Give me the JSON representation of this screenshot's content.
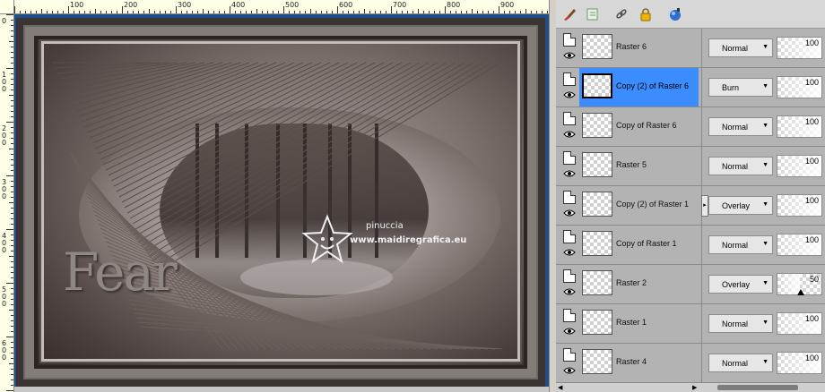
{
  "ruler": {
    "top_labels": [
      "100",
      "200",
      "300",
      "400",
      "500",
      "600",
      "700",
      "800",
      "900"
    ],
    "left_labels": [
      "0",
      "100",
      "200",
      "300",
      "400",
      "500",
      "600"
    ]
  },
  "artwork": {
    "logo_text": "Fear",
    "watermark_name": "pinuccia",
    "watermark_url": "www.maidiregrafica.eu"
  },
  "toolbar": {
    "icons": [
      "brush-icon",
      "layer-properties-icon",
      "link-icon",
      "lock-icon",
      "mask-icon"
    ]
  },
  "layers": [
    {
      "name": "Raster 6",
      "blend": "Normal",
      "opacity": "100",
      "selected": false
    },
    {
      "name": "Copy (2) of Raster 6",
      "blend": "Burn",
      "opacity": "100",
      "selected": true
    },
    {
      "name": "Copy of Raster 6",
      "blend": "Normal",
      "opacity": "100",
      "selected": false
    },
    {
      "name": "Raster 5",
      "blend": "Normal",
      "opacity": "100",
      "selected": false
    },
    {
      "name": "Copy (2) of Raster 1",
      "blend": "Overlay",
      "opacity": "100",
      "selected": false
    },
    {
      "name": "Copy of Raster 1",
      "blend": "Normal",
      "opacity": "100",
      "selected": false
    },
    {
      "name": "Raster 2",
      "blend": "Overlay",
      "opacity": "50",
      "selected": false
    },
    {
      "name": "Raster 1",
      "blend": "Normal",
      "opacity": "100",
      "selected": false
    },
    {
      "name": "Raster 4",
      "blend": "Normal",
      "opacity": "100",
      "selected": false
    }
  ],
  "colors": {
    "selection": "#3b8cff",
    "palette_bg": "#a8a8a8",
    "canvas_bg": "#1f4f8a"
  }
}
